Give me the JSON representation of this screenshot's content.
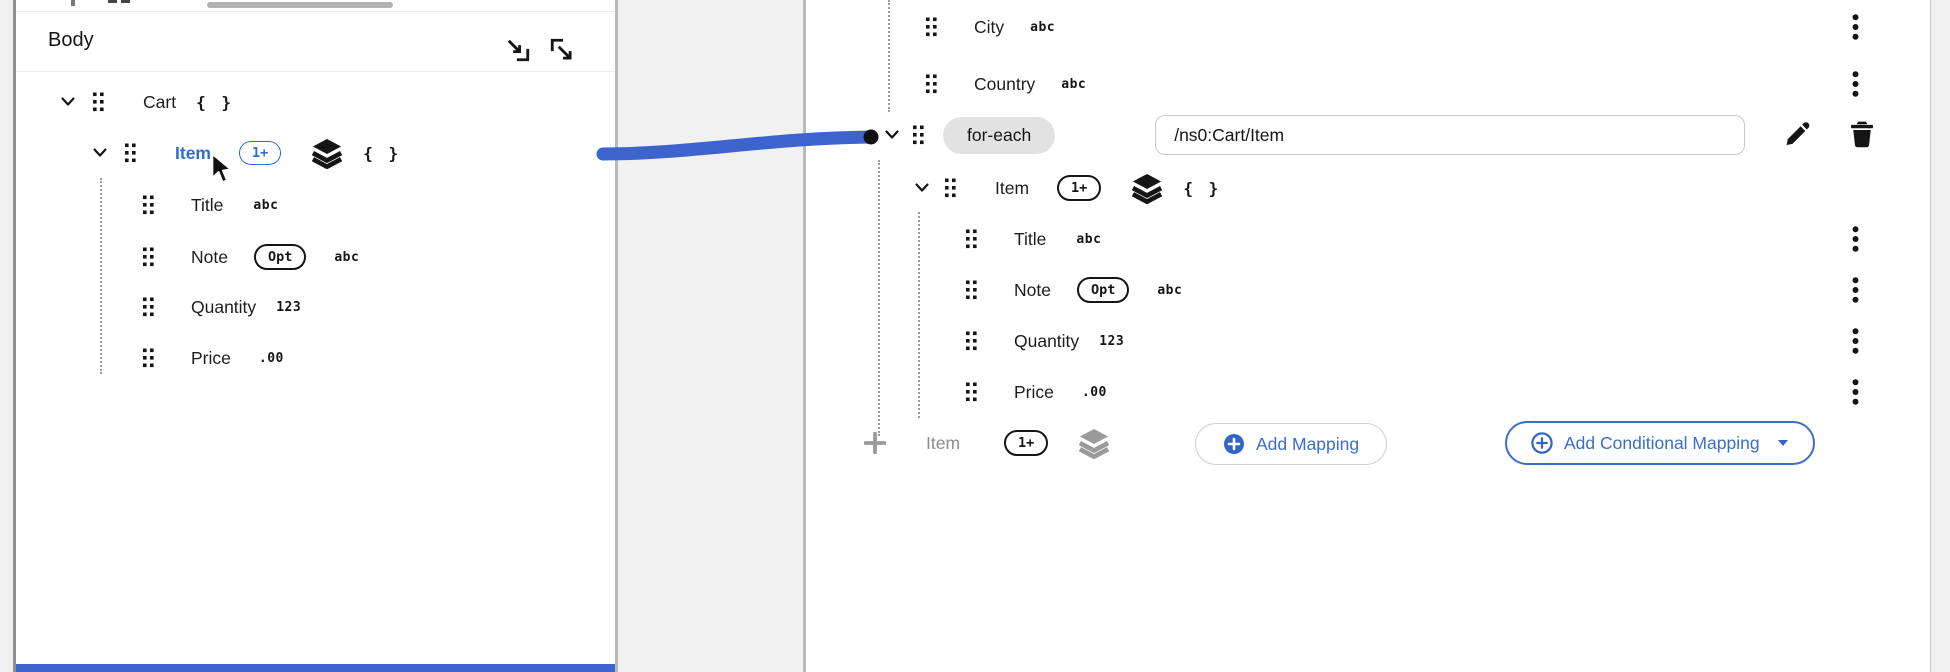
{
  "source_panel": {
    "title": "Body",
    "tree": {
      "cart": {
        "label": "Cart",
        "braces": "{ }"
      },
      "item": {
        "label": "Item",
        "badge": "1+",
        "braces": "{ }"
      },
      "fields": [
        {
          "label": "Title",
          "type": "abc"
        },
        {
          "label": "Note",
          "opt": "Opt",
          "type": "abc"
        },
        {
          "label": "Quantity",
          "type": "123"
        },
        {
          "label": "Price",
          "type": ".00"
        }
      ]
    }
  },
  "target_panel": {
    "fields_top": [
      {
        "label": "City",
        "type": "abc"
      },
      {
        "label": "Country",
        "type": "abc"
      }
    ],
    "foreach": {
      "label": "for-each",
      "expression": "/ns0:Cart/Item"
    },
    "item": {
      "label": "Item",
      "badge": "1+",
      "braces": "{ }"
    },
    "fields": [
      {
        "label": "Title",
        "type": "abc"
      },
      {
        "label": "Note",
        "opt": "Opt",
        "type": "abc"
      },
      {
        "label": "Quantity",
        "type": "123"
      },
      {
        "label": "Price",
        "type": ".00"
      }
    ],
    "add_row": {
      "label": "Item",
      "badge": "1+"
    },
    "buttons": {
      "add_mapping": "Add Mapping",
      "add_conditional_mapping": "Add Conditional Mapping"
    }
  },
  "icons": {
    "attach": "attach-schema-icon",
    "detach": "detach-schema-icon",
    "drag": "grip-icon",
    "collection": "layers-icon",
    "object": "braces-icon",
    "menu": "kebab-icon",
    "edit": "pencil-icon",
    "delete": "trash-icon"
  },
  "colors": {
    "accent_blue": "#3d63cc",
    "selected_blue": "#2e6ed0",
    "button_blue": "#3c6ec9",
    "text": "#151515",
    "muted": "#8d8d8d",
    "canvas_bg": "#f1f1f1"
  }
}
